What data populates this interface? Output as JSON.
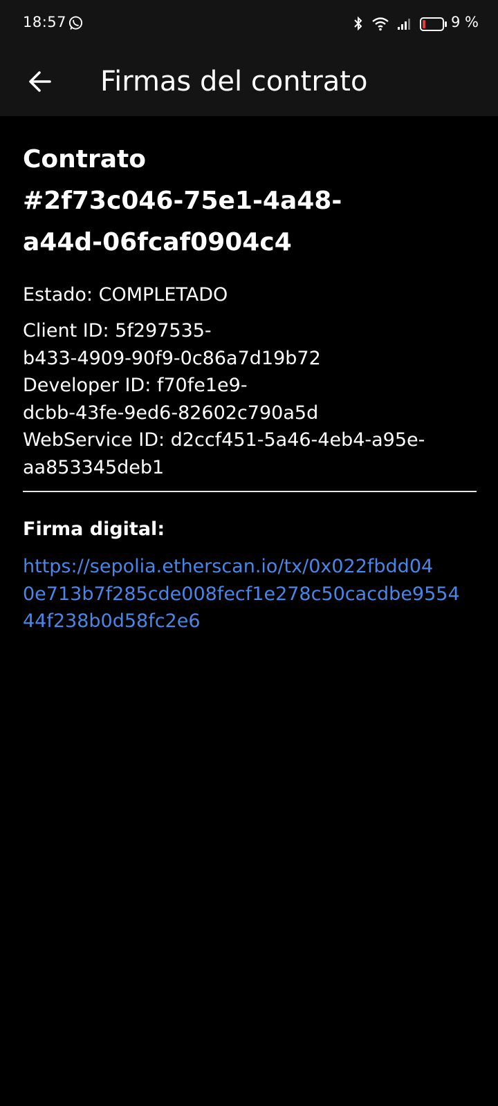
{
  "status_bar": {
    "time": "18:57",
    "battery_text": "9 %",
    "icons": [
      "whatsapp-icon",
      "bluetooth-icon",
      "wifi-icon",
      "signal-icon",
      "battery-icon"
    ]
  },
  "app_bar": {
    "title": "Firmas del contrato",
    "back_icon": "arrow-back-icon"
  },
  "contract": {
    "title_line1": "Contrato",
    "title_line2": "#2f73c046-75e1-4a48-",
    "title_line3": "a44d-06fcaf0904c4",
    "estado": "Estado: COMPLETADO",
    "id_lines": [
      "Client ID: 5f297535-",
      "b433-4909-90f9-0c86a7d19b72",
      "Developer ID: f70fe1e9-",
      "dcbb-43fe-9ed6-82602c790a5d",
      "WebService ID: d2ccf451-5a46-4eb4-a95e-",
      "aa853345deb1"
    ]
  },
  "firma": {
    "label": "Firma digital:",
    "link_lines": [
      "https://sepolia.etherscan.io/tx/0x022fbdd04",
      "0e713b7f285cde008fecf1e278c50cacdbe9554",
      "44f238b0d58fc2e6"
    ]
  },
  "colors": {
    "background": "#000000",
    "bar_background": "#141414",
    "link": "#4a86e8",
    "battery_low": "#e53935"
  }
}
